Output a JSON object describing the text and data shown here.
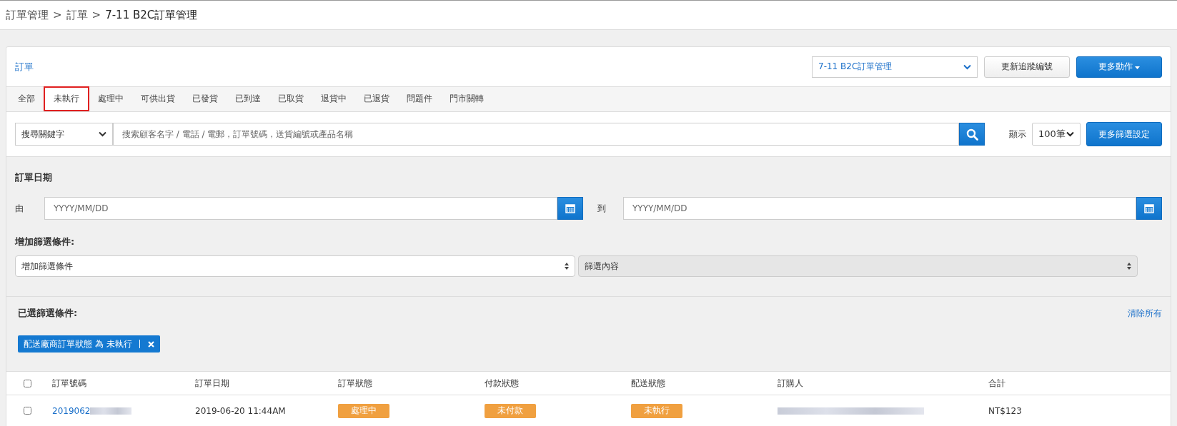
{
  "breadcrumb": {
    "separator": ">",
    "items": [
      "訂單管理",
      "訂單",
      "7-11 B2C訂單管理"
    ]
  },
  "card": {
    "title": "訂單",
    "store_select": "7-11 B2C訂單管理",
    "buttons": [
      {
        "label": "更新追蹤編號",
        "kind": "default"
      },
      {
        "label": "更多動作",
        "kind": "primary-caret"
      }
    ]
  },
  "tabs": [
    {
      "label": "全部",
      "selected": false
    },
    {
      "label": "未執行",
      "selected": true
    },
    {
      "label": "處理中",
      "selected": false
    },
    {
      "label": "可供出貨",
      "selected": false
    },
    {
      "label": "已發貨",
      "selected": false
    },
    {
      "label": "已到達",
      "selected": false
    },
    {
      "label": "已取貨",
      "selected": false
    },
    {
      "label": "退貨中",
      "selected": false
    },
    {
      "label": "已退貨",
      "selected": false
    },
    {
      "label": "問題件",
      "selected": false
    },
    {
      "label": "門市關轉",
      "selected": false
    }
  ],
  "search": {
    "type_select": "搜尋關鍵字",
    "placeholder": "搜索顧客名字 / 電話 / 電郵，訂單號碼，送貨編號或產品名稱",
    "show_label": "顯示",
    "show_select": "100筆",
    "filter_button": "更多篩選設定"
  },
  "date_filter": {
    "title": "訂單日期",
    "from_label": "由",
    "from_placeholder": "YYYY/MM/DD",
    "to_label": "到",
    "to_placeholder": "YYYY/MM/DD"
  },
  "add_filter": {
    "title": "增加篩選條件:",
    "condition_select": "增加篩選條件",
    "content_select": "篩選內容"
  },
  "selected_filters": {
    "title": "已選篩選條件:",
    "clear_all": "清除所有",
    "tags": [
      "配送廠商訂單狀態 為 未執行"
    ]
  },
  "table": {
    "columns": [
      "訂單號碼",
      "訂單日期",
      "訂單狀態",
      "付款狀態",
      "配送狀態",
      "訂購人",
      "合計"
    ],
    "header_checked": false,
    "rows": [
      {
        "checked": false,
        "order_number": "2019062",
        "date": "2019-06-20 11:44AM",
        "order_status": "處理中",
        "payment_status": "未付款",
        "shipping_status": "未執行",
        "total": "NT$123"
      }
    ]
  }
}
